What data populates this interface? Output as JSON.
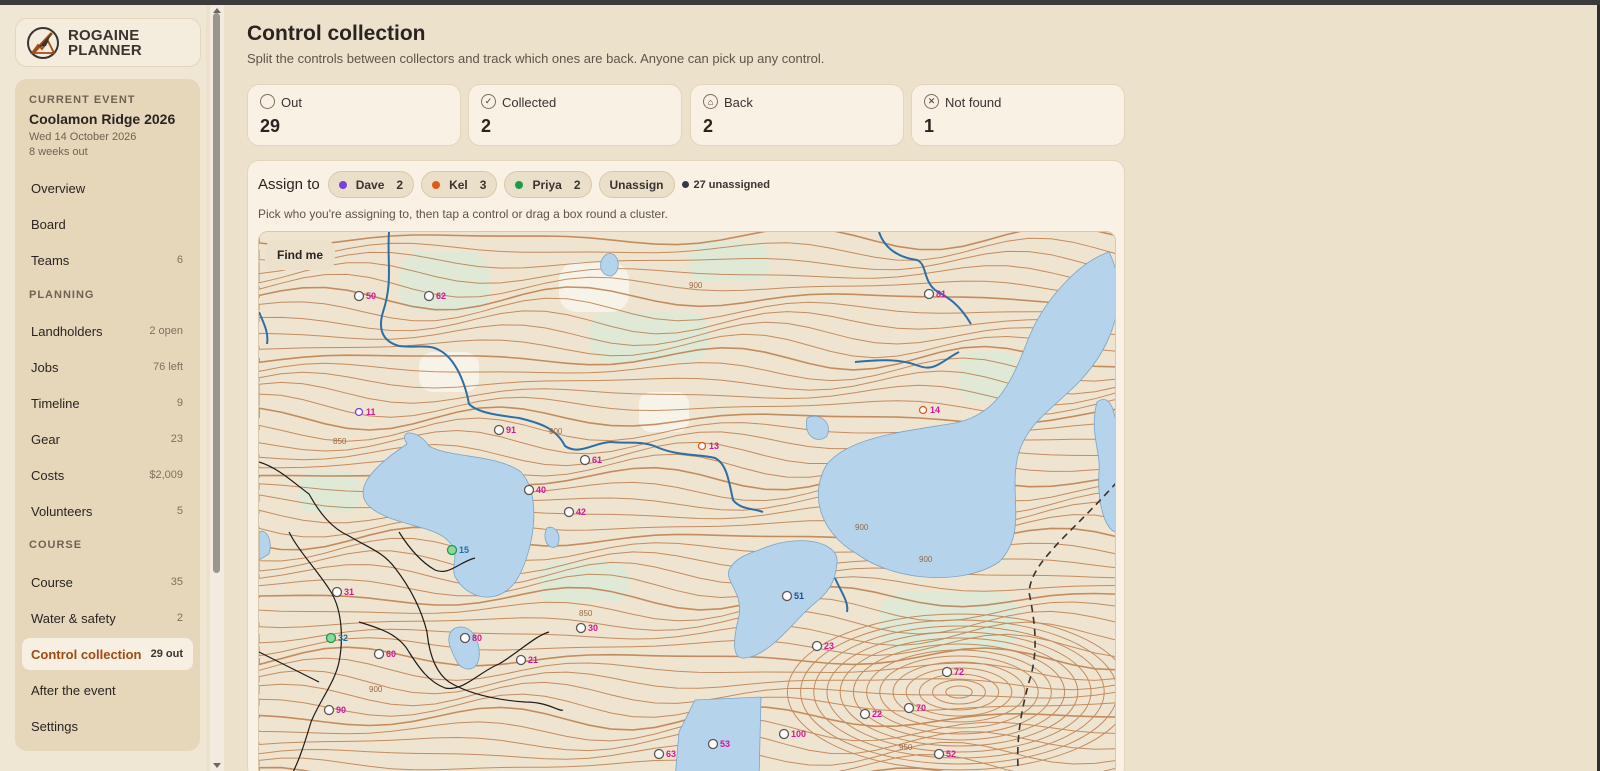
{
  "logo": {
    "line1": "ROGAINE",
    "line2": "PLANNER"
  },
  "event": {
    "label": "CURRENT EVENT",
    "name": "Coolamon Ridge 2026",
    "date": "Wed 14 October 2026",
    "countdown": "8 weeks out"
  },
  "nav": {
    "top": [
      {
        "label": "Overview",
        "count": ""
      },
      {
        "label": "Board",
        "count": ""
      },
      {
        "label": "Teams",
        "count": "6"
      }
    ],
    "planning_label": "PLANNING",
    "planning": [
      {
        "label": "Landholders",
        "count": "2 open"
      },
      {
        "label": "Jobs",
        "count": "76 left"
      },
      {
        "label": "Timeline",
        "count": "9"
      },
      {
        "label": "Gear",
        "count": "23"
      },
      {
        "label": "Costs",
        "count": "$2,009"
      },
      {
        "label": "Volunteers",
        "count": "5"
      }
    ],
    "course_label": "COURSE",
    "course": [
      {
        "label": "Course",
        "count": "35"
      },
      {
        "label": "Water & safety",
        "count": "2"
      },
      {
        "label": "Control collection",
        "count": "29 out"
      },
      {
        "label": "After the event",
        "count": ""
      },
      {
        "label": "Settings",
        "count": ""
      }
    ]
  },
  "page": {
    "title": "Control collection",
    "subtitle": "Split the controls between collectors and track which ones are back. Anyone can pick up any control."
  },
  "stats": [
    {
      "label": "Out",
      "value": "29",
      "icon": "circle-icon",
      "glyph": ""
    },
    {
      "label": "Collected",
      "value": "2",
      "icon": "check-icon",
      "glyph": "✓"
    },
    {
      "label": "Back",
      "value": "2",
      "icon": "home-icon",
      "glyph": "⌂"
    },
    {
      "label": "Not found",
      "value": "1",
      "icon": "x-icon",
      "glyph": "✕"
    }
  ],
  "assign": {
    "label": "Assign to",
    "collectors": [
      {
        "name": "Dave",
        "count": "2",
        "color": "#7a3fe0"
      },
      {
        "name": "Kel",
        "count": "3",
        "color": "#e05a1a"
      },
      {
        "name": "Priya",
        "count": "2",
        "color": "#1f9a4a"
      }
    ],
    "unassign_label": "Unassign",
    "unassigned_text": "27 unassigned",
    "hint": "Pick who you're assigning to, then tap a control or drag a box round a cluster."
  },
  "map": {
    "find_me": "Find me",
    "controls": [
      {
        "n": "50",
        "state": "out"
      },
      {
        "n": "62",
        "state": "out"
      },
      {
        "n": "81",
        "state": "out"
      },
      {
        "n": "11",
        "state": "dave"
      },
      {
        "n": "14",
        "state": "kel"
      },
      {
        "n": "91",
        "state": "out"
      },
      {
        "n": "13",
        "state": "kel"
      },
      {
        "n": "61",
        "state": "out"
      },
      {
        "n": "40",
        "state": "out"
      },
      {
        "n": "42",
        "state": "out"
      },
      {
        "n": "15",
        "state": "priya"
      },
      {
        "n": "51",
        "state": "collected"
      },
      {
        "n": "31",
        "state": "out"
      },
      {
        "n": "30",
        "state": "out"
      },
      {
        "n": "32",
        "state": "priya"
      },
      {
        "n": "80",
        "state": "out"
      },
      {
        "n": "60",
        "state": "out"
      },
      {
        "n": "23",
        "state": "out"
      },
      {
        "n": "21",
        "state": "out"
      },
      {
        "n": "72",
        "state": "out"
      },
      {
        "n": "90",
        "state": "out"
      },
      {
        "n": "22",
        "state": "out"
      },
      {
        "n": "70",
        "state": "out"
      },
      {
        "n": "100",
        "state": "out"
      },
      {
        "n": "53",
        "state": "out"
      },
      {
        "n": "63",
        "state": "out"
      },
      {
        "n": "52",
        "state": "out"
      }
    ],
    "contour_labels": [
      "900",
      "900",
      "900",
      "850",
      "900",
      "950",
      "850",
      "900"
    ]
  },
  "colors": {
    "accent": "#a14a14",
    "control_label": "#d0189a",
    "lake": "#b5d3ea",
    "stream": "#2f6ea3",
    "contour": "#b56f3a"
  }
}
